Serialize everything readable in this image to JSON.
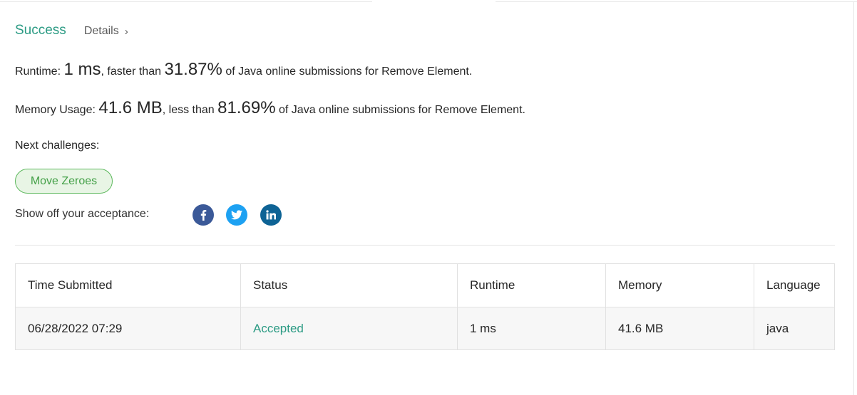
{
  "result": {
    "status": "Success",
    "details_label": "Details",
    "details_chevron": "›"
  },
  "runtime": {
    "label": "Runtime:",
    "value": "1 ms",
    "comparison_text": ", faster than",
    "percent": "31.87%",
    "suffix": "of Java online submissions for Remove Element."
  },
  "memory": {
    "label": "Memory Usage:",
    "value": "41.6 MB",
    "comparison_text": ", less than",
    "percent": "81.69%",
    "suffix": "of Java online submissions for Remove Element."
  },
  "next_challenges": {
    "label": "Next challenges:",
    "items": [
      "Move Zeroes"
    ]
  },
  "share": {
    "label": "Show off your acceptance:",
    "icons": [
      "facebook-icon",
      "twitter-icon",
      "linkedin-icon"
    ],
    "colors": {
      "facebook": "#3b5998",
      "twitter": "#1da1f2",
      "linkedin": "#0e6395"
    }
  },
  "submissions": {
    "headers": [
      "Time Submitted",
      "Status",
      "Runtime",
      "Memory",
      "Language"
    ],
    "rows": [
      [
        "06/28/2022 07:29",
        "Accepted",
        "1 ms",
        "41.6 MB",
        "java"
      ]
    ]
  },
  "colors": {
    "success": "#2c9b84",
    "tag_border": "#5cb85c",
    "tag_bg": "#e8f5e5"
  }
}
